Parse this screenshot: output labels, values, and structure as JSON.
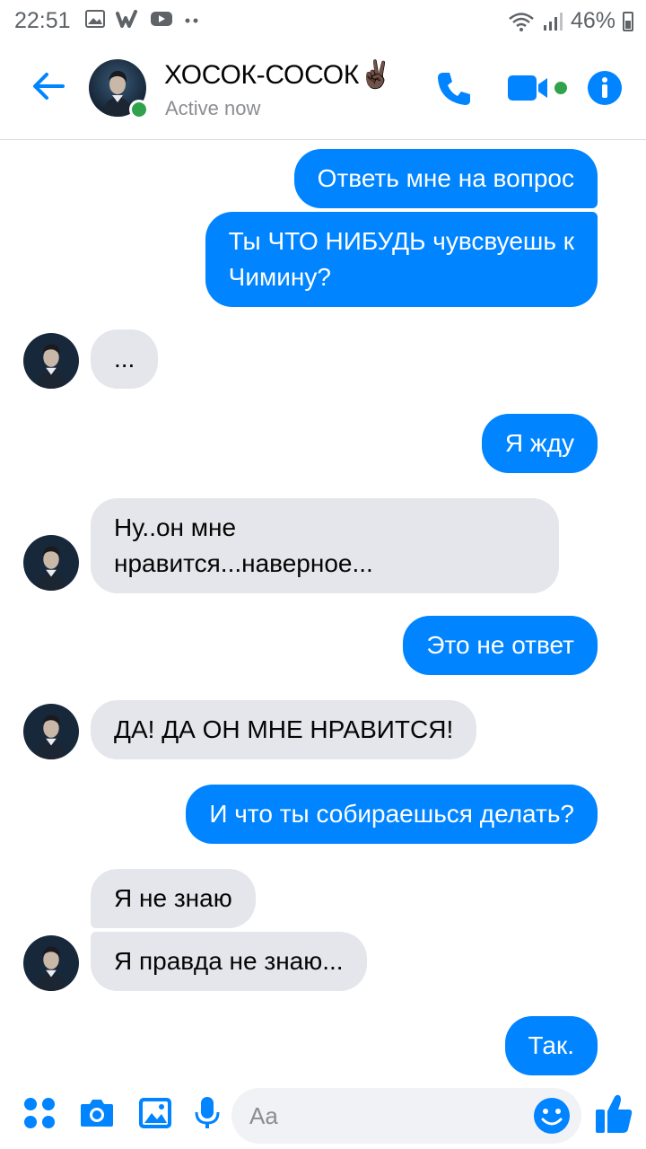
{
  "status_bar": {
    "time": "22:51",
    "battery": "46%",
    "icons": [
      "gallery-icon",
      "wattpad-icon",
      "youtube-icon",
      "more-dots-icon",
      "wifi-icon",
      "signal-icon",
      "battery-icon"
    ]
  },
  "header": {
    "contact_name": "ХОСОК-СОСОК✌🏿",
    "contact_status": "Active now",
    "accent_color": "#0084ff",
    "online_color": "#31a24c"
  },
  "messages": [
    {
      "side": "out",
      "text": "Ответь мне на вопрос"
    },
    {
      "side": "out",
      "text": "Ты ЧТО НИБУДЬ чувсвуешь к",
      "text2": "Чимину?"
    },
    {
      "side": "in",
      "text": "..."
    },
    {
      "side": "out",
      "text": "Я жду"
    },
    {
      "side": "in",
      "text": "Ну..он мне",
      "text2": "нравится...наверное..."
    },
    {
      "side": "out",
      "text": "Это не ответ"
    },
    {
      "side": "in",
      "text": "ДА! ДА ОН МНЕ НРАВИТСЯ!"
    },
    {
      "side": "out",
      "text": "И что ты собираешься делать?"
    },
    {
      "side": "in",
      "text": "Я не знаю"
    },
    {
      "side": "in",
      "text": "Я правда не знаю..."
    },
    {
      "side": "out",
      "text": "Так."
    }
  ],
  "composer": {
    "placeholder": "Aa",
    "icons": [
      "apps-icon",
      "camera-icon",
      "gallery-icon",
      "microphone-icon",
      "emoji-icon",
      "thumbs-up-icon"
    ]
  }
}
